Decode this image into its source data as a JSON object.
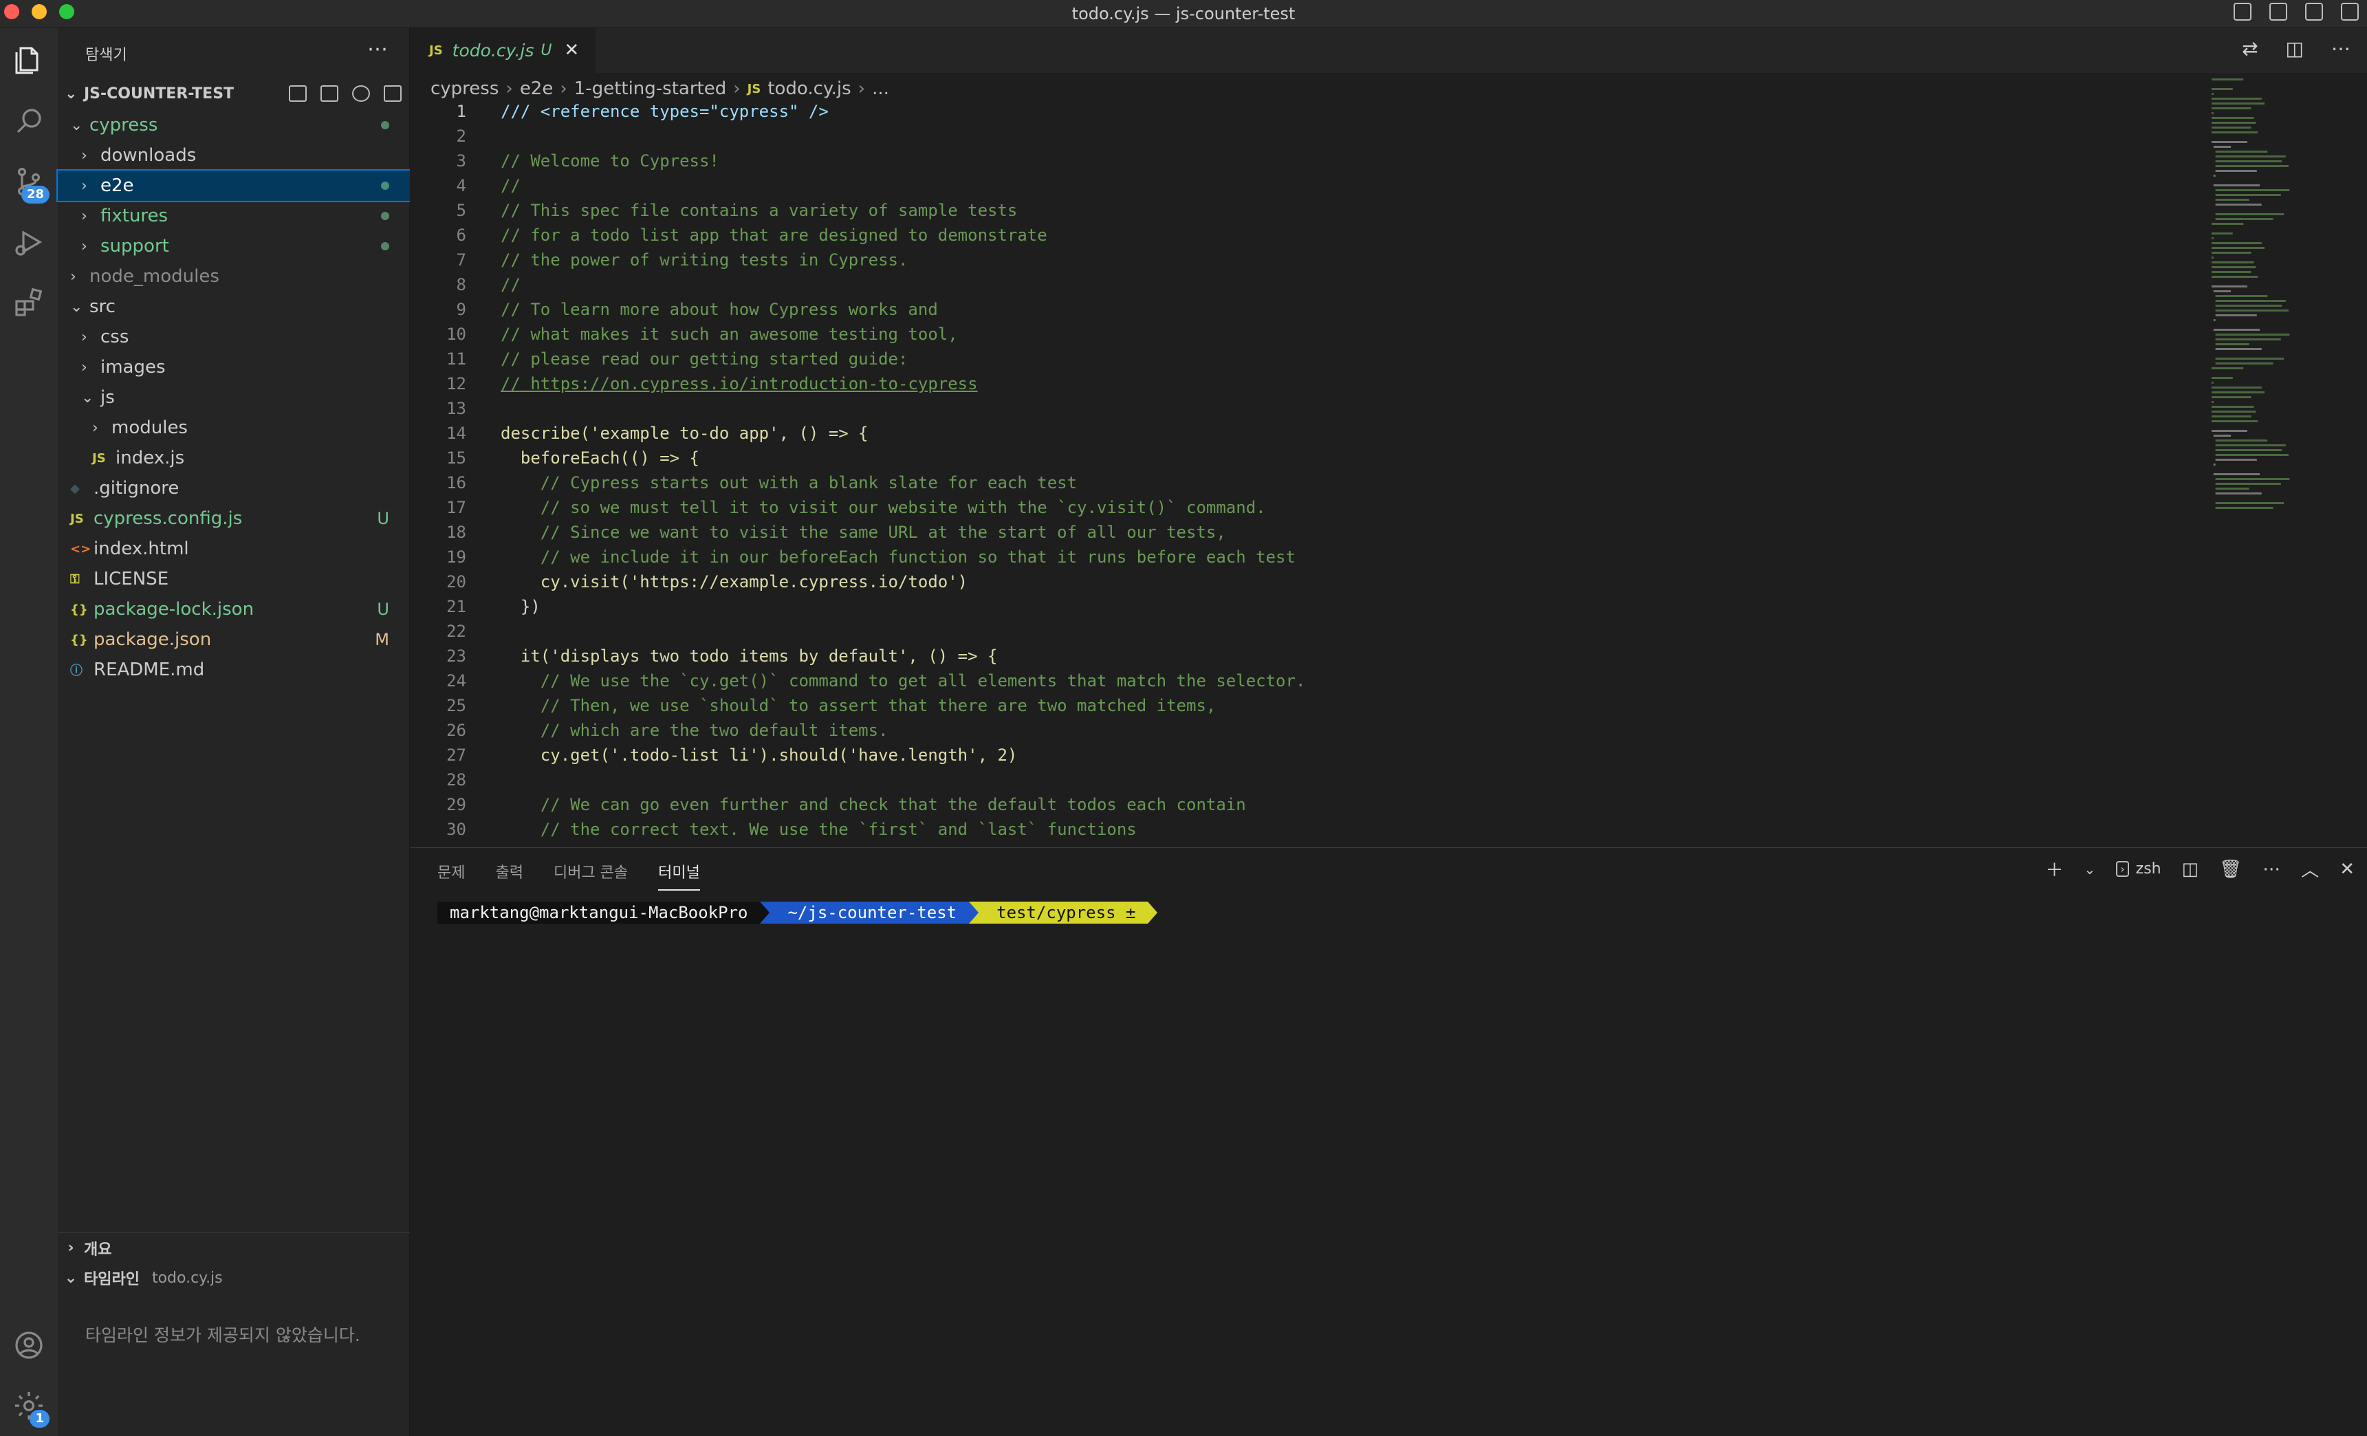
{
  "window": {
    "title": "todo.cy.js — js-counter-test"
  },
  "activity": {
    "scm_badge": "28",
    "settings_badge": "1"
  },
  "sidebar": {
    "title": "탐색기",
    "more": "⋯",
    "project": "JS-COUNTER-TEST",
    "tree": [
      {
        "label": "cypress",
        "indent": 0,
        "type": "folder",
        "open": true,
        "color": "#73c991",
        "dot": true
      },
      {
        "label": "downloads",
        "indent": 1,
        "type": "folder",
        "open": false,
        "color": "#cccccc"
      },
      {
        "label": "e2e",
        "indent": 1,
        "type": "folder",
        "open": false,
        "color": "#ffffff",
        "dot": true,
        "selected": true
      },
      {
        "label": "fixtures",
        "indent": 1,
        "type": "folder",
        "open": false,
        "color": "#73c991",
        "dot": true
      },
      {
        "label": "support",
        "indent": 1,
        "type": "folder",
        "open": false,
        "color": "#73c991",
        "dot": true
      },
      {
        "label": "node_modules",
        "indent": 0,
        "type": "folder",
        "open": false,
        "color": "#8c8c8c"
      },
      {
        "label": "src",
        "indent": 0,
        "type": "folder",
        "open": true,
        "color": "#cccccc"
      },
      {
        "label": "css",
        "indent": 1,
        "type": "folder",
        "open": false,
        "color": "#cccccc"
      },
      {
        "label": "images",
        "indent": 1,
        "type": "folder",
        "open": false,
        "color": "#cccccc"
      },
      {
        "label": "js",
        "indent": 1,
        "type": "folder",
        "open": true,
        "color": "#cccccc"
      },
      {
        "label": "modules",
        "indent": 2,
        "type": "folder",
        "open": false,
        "color": "#cccccc"
      },
      {
        "label": "index.js",
        "indent": 2,
        "type": "js",
        "color": "#cccccc"
      },
      {
        "label": ".gitignore",
        "indent": 0,
        "type": "gitignore",
        "color": "#cccccc"
      },
      {
        "label": "cypress.config.js",
        "indent": 0,
        "type": "js",
        "color": "#73c991",
        "status": "U"
      },
      {
        "label": "index.html",
        "indent": 0,
        "type": "html",
        "color": "#cccccc"
      },
      {
        "label": "LICENSE",
        "indent": 0,
        "type": "license",
        "color": "#cccccc"
      },
      {
        "label": "package-lock.json",
        "indent": 0,
        "type": "json",
        "color": "#73c991",
        "status": "U"
      },
      {
        "label": "package.json",
        "indent": 0,
        "type": "json",
        "color": "#e2c08d",
        "status": "M"
      },
      {
        "label": "README.md",
        "indent": 0,
        "type": "info",
        "color": "#cccccc"
      }
    ],
    "outline": "개요",
    "timeline": "타임라인",
    "timeline_file": "todo.cy.js",
    "timeline_empty": "타임라인 정보가 제공되지 않았습니다."
  },
  "editor": {
    "tab": {
      "lang": "JS",
      "name": "todo.cy.js",
      "status": "U",
      "close": "✕"
    },
    "breadcrumb": [
      "cypress",
      "e2e",
      "1-getting-started",
      "todo.cy.js",
      "..."
    ],
    "breadcrumb_js": "JS",
    "lines": [
      "/// <reference types=\"cypress\" />",
      "",
      "// Welcome to Cypress!",
      "//",
      "// This spec file contains a variety of sample tests",
      "// for a todo list app that are designed to demonstrate",
      "// the power of writing tests in Cypress.",
      "//",
      "// To learn more about how Cypress works and",
      "// what makes it such an awesome testing tool,",
      "// please read our getting started guide:",
      "// https://on.cypress.io/introduction-to-cypress",
      "",
      "describe('example to-do app', () => {",
      "  beforeEach(() => {",
      "    // Cypress starts out with a blank slate for each test",
      "    // so we must tell it to visit our website with the `cy.visit()` command.",
      "    // Since we want to visit the same URL at the start of all our tests,",
      "    // we include it in our beforeEach function so that it runs before each test",
      "    cy.visit('https://example.cypress.io/todo')",
      "  })",
      "",
      "  it('displays two todo items by default', () => {",
      "    // We use the `cy.get()` command to get all elements that match the selector.",
      "    // Then, we use `should` to assert that there are two matched items,",
      "    // which are the two default items.",
      "    cy.get('.todo-list li').should('have.length', 2)",
      "",
      "    // We can go even further and check that the default todos each contain",
      "    // the correct text. We use the `first` and `last` functions"
    ]
  },
  "panel": {
    "tabs": [
      "문제",
      "출력",
      "디버그 콘솔",
      "터미널"
    ],
    "active_tab": "터미널",
    "shell": "zsh",
    "prompt": {
      "user": "marktang@marktangui-MacBookPro",
      "path": "~/js-counter-test",
      "branch": "test/cypress ±",
      "branch_icon": ""
    }
  }
}
